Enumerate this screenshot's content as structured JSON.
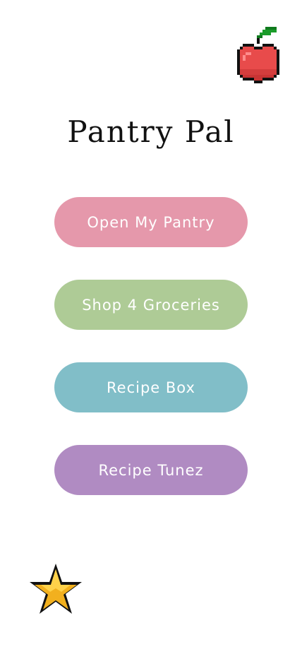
{
  "app": {
    "title": "Pantry Pal"
  },
  "menu": {
    "items": [
      {
        "label": "Open My Pantry",
        "color": "#e598ab"
      },
      {
        "label": "Shop 4 Groceries",
        "color": "#aecb96"
      },
      {
        "label": "Recipe Box",
        "color": "#81bec8"
      },
      {
        "label": "Recipe Tunez",
        "color": "#b08bc2"
      }
    ]
  },
  "icons": {
    "top_right": "apple-icon",
    "bottom_left": "star-icon"
  },
  "colors": {
    "background": "#ffffff",
    "title": "#111111",
    "button_text": "#ffffff"
  }
}
